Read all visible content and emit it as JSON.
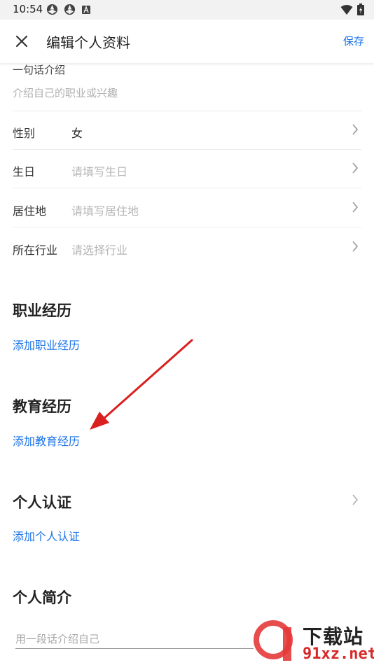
{
  "status_bar": {
    "time": "10:54"
  },
  "header": {
    "title": "编辑个人资料",
    "save_label": "保存"
  },
  "bio": {
    "label": "一句话介绍",
    "placeholder": "介绍自己的职业或兴趣"
  },
  "rows": [
    {
      "label": "性别",
      "value": "女",
      "is_placeholder": false
    },
    {
      "label": "生日",
      "value": "请填写生日",
      "is_placeholder": true
    },
    {
      "label": "居住地",
      "value": "请填写居住地",
      "is_placeholder": true
    },
    {
      "label": "所在行业",
      "value": "请选择行业",
      "is_placeholder": true
    }
  ],
  "sections": {
    "career": {
      "title": "职业经历",
      "add_label": "添加职业经历"
    },
    "education": {
      "title": "教育经历",
      "add_label": "添加教育经历"
    },
    "certification": {
      "title": "个人认证",
      "add_label": "添加个人认证"
    },
    "profile": {
      "title": "个人简介",
      "placeholder": "用一段话介绍自己"
    }
  },
  "watermark": {
    "top_text": "下载站",
    "bottom_text": "91xz.net"
  },
  "colors": {
    "accent": "#1a73e8",
    "arrow": "#d9201f",
    "text": "#222222",
    "placeholder": "#b5b5b5"
  }
}
